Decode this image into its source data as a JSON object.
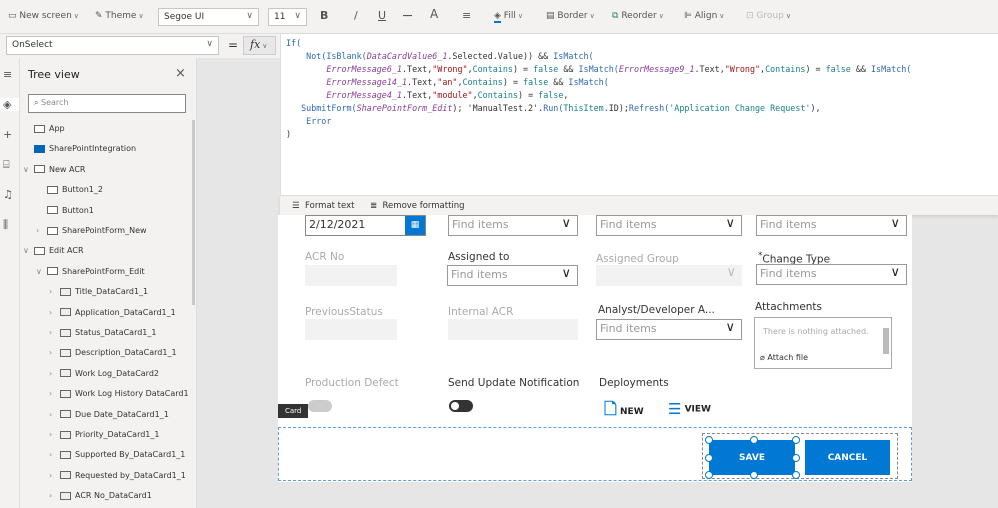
{
  "toolbar": {
    "new_screen": "New screen",
    "theme": "Theme",
    "font": "Segoe UI",
    "font_size": "11",
    "bold": "B",
    "italic": "/",
    "underline": "U",
    "strike": "—",
    "font_color": "A",
    "align_text": "≡",
    "fill": "Fill",
    "border": "Border",
    "reorder": "Reorder",
    "align": "Align",
    "group": "Group"
  },
  "formula": {
    "property": "OnSelect",
    "equals": "=",
    "fx": "fx",
    "lines": [
      [
        [
          "fn",
          "If("
        ]
      ],
      [
        [
          "pl",
          "    "
        ],
        [
          "fn",
          "Not(IsBlank("
        ],
        [
          "ctl",
          "DataCardValue6_1"
        ],
        [
          "pl",
          ".Selected.Value)) && "
        ],
        [
          "fn",
          "IsMatch("
        ]
      ],
      [
        [
          "pl",
          "        "
        ],
        [
          "ctl",
          "ErrorMessage6_1"
        ],
        [
          "pl",
          ".Text,"
        ],
        [
          "str",
          "\"Wrong\""
        ],
        [
          "pl",
          ","
        ],
        [
          "en",
          "Contains"
        ],
        [
          "pl",
          ") = "
        ],
        [
          "en",
          "false"
        ],
        [
          "pl",
          " && "
        ],
        [
          "fn",
          "IsMatch("
        ],
        [
          "ctl",
          "ErrorMessage9_1"
        ],
        [
          "pl",
          ".Text,"
        ],
        [
          "str",
          "\"Wrong\""
        ],
        [
          "pl",
          ","
        ],
        [
          "en",
          "Contains"
        ],
        [
          "pl",
          ") = "
        ],
        [
          "en",
          "false"
        ],
        [
          "pl",
          " && "
        ],
        [
          "fn",
          "IsMatch("
        ]
      ],
      [
        [
          "pl",
          "        "
        ],
        [
          "ctl",
          "ErrorMessage14_1"
        ],
        [
          "pl",
          ".Text,"
        ],
        [
          "str",
          "\"an\""
        ],
        [
          "pl",
          ","
        ],
        [
          "en",
          "Contains"
        ],
        [
          "pl",
          ") = "
        ],
        [
          "en",
          "false"
        ],
        [
          "pl",
          " && "
        ],
        [
          "fn",
          "IsMatch("
        ]
      ],
      [
        [
          "pl",
          "        "
        ],
        [
          "ctl",
          "ErrorMessage4_1"
        ],
        [
          "pl",
          ".Text,"
        ],
        [
          "str",
          "\"module\""
        ],
        [
          "pl",
          ","
        ],
        [
          "en",
          "Contains"
        ],
        [
          "pl",
          ") = "
        ],
        [
          "en",
          "false"
        ],
        [
          "pl",
          ","
        ]
      ],
      [
        [
          "pl",
          "   "
        ],
        [
          "fn",
          "SubmitForm("
        ],
        [
          "ctl",
          "SharePointForm_Edit"
        ],
        [
          "pl",
          "); 'ManualTest.2'."
        ],
        [
          "fn",
          "Run("
        ],
        [
          "en",
          "ThisItem"
        ],
        [
          "pl",
          ".ID);"
        ],
        [
          "fn",
          "Refresh("
        ],
        [
          "en",
          "'Application Change Request'"
        ],
        [
          "pl",
          "),"
        ]
      ],
      [
        [
          "pl",
          "    "
        ],
        [
          "fn",
          "Error"
        ]
      ],
      [
        [
          "pl",
          ")"
        ]
      ]
    ],
    "format_text": "Format text",
    "remove_formatting": "Remove formatting"
  },
  "tree": {
    "title": "Tree view",
    "search_placeholder": "Search",
    "items": [
      {
        "label": "App",
        "level": 0,
        "chev": false,
        "icon": "app-icon"
      },
      {
        "label": "SharePointIntegration",
        "level": 0,
        "chev": false,
        "icon": "sharepoint-icon"
      },
      {
        "label": "New ACR",
        "level": 0,
        "chev": true,
        "icon": "screen-icon"
      },
      {
        "label": "Button1_2",
        "level": 1,
        "chev": false,
        "icon": "button-icon"
      },
      {
        "label": "Button1",
        "level": 1,
        "chev": false,
        "icon": "button-icon"
      },
      {
        "label": "SharePointForm_New",
        "level": 1,
        "chev": true,
        "icon": "form-icon"
      },
      {
        "label": "Edit ACR",
        "level": 0,
        "chev": true,
        "icon": "screen-icon"
      },
      {
        "label": "SharePointForm_Edit",
        "level": 1,
        "chev": true,
        "icon": "form-icon"
      },
      {
        "label": "Title_DataCard1_1",
        "level": 2,
        "chev": true,
        "icon": "card-icon"
      },
      {
        "label": "Application_DataCard1_1",
        "level": 2,
        "chev": true,
        "icon": "card-icon"
      },
      {
        "label": "Status_DataCard1_1",
        "level": 2,
        "chev": true,
        "icon": "card-icon"
      },
      {
        "label": "Description_DataCard1_1",
        "level": 2,
        "chev": true,
        "icon": "card-icon"
      },
      {
        "label": "Work Log_DataCard2",
        "level": 2,
        "chev": true,
        "icon": "card-icon"
      },
      {
        "label": "Work Log History DataCard1",
        "level": 2,
        "chev": true,
        "icon": "card-icon"
      },
      {
        "label": "Due Date_DataCard1_1",
        "level": 2,
        "chev": true,
        "icon": "card-icon"
      },
      {
        "label": "Priority_DataCard1_1",
        "level": 2,
        "chev": true,
        "icon": "card-icon"
      },
      {
        "label": "Supported By_DataCard1_1",
        "level": 2,
        "chev": true,
        "icon": "card-icon"
      },
      {
        "label": "Requested by_DataCard1_1",
        "level": 2,
        "chev": true,
        "icon": "card-icon"
      },
      {
        "label": "ACR No_DataCard1",
        "level": 2,
        "chev": true,
        "icon": "card-icon"
      }
    ]
  },
  "form": {
    "date": "2/12/2021",
    "find": "Find items",
    "acr_no": "ACR No",
    "assigned_to": "Assigned to",
    "assigned_group": "Assigned Group",
    "change_type_req": "*",
    "change_type": "Change Type",
    "previous_status": "PreviousStatus",
    "internal_acr": "Internal ACR",
    "analyst": "Analyst/Developer A...",
    "attachments": "Attachments",
    "nothing_attached": "There is nothing attached.",
    "attach_file": "Attach file",
    "production_defect": "Production Defect",
    "send_update": "Send Update Notification",
    "deployments": "Deployments",
    "new": "NEW",
    "view": "VIEW",
    "card_tooltip": "Card",
    "save": "SAVE",
    "cancel": "CANCEL"
  },
  "colors": {
    "accent": "#0078d4",
    "toolbar_bg": "#f3f2f1"
  }
}
